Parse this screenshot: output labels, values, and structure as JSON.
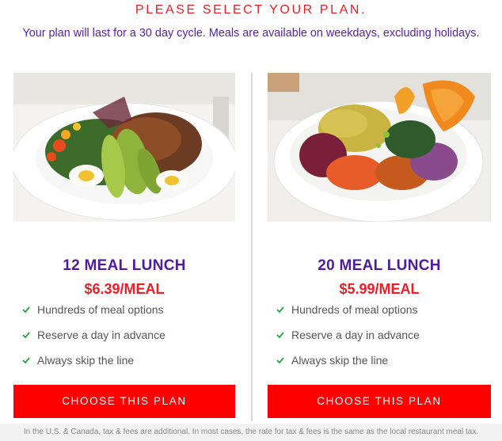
{
  "header": {
    "title": "PLEASE SELECT YOUR PLAN.",
    "subtitle": "Your plan will last for a 30 day cycle. Meals are available on weekdays, excluding holidays."
  },
  "plans": [
    {
      "image_alt": "Salad with egg, avocado, tomatoes and greens",
      "title": "12 MEAL LUNCH",
      "price": "$6.39/MEAL",
      "features": [
        "Hundreds of meal options",
        "Reserve a day in advance",
        "Always skip the line"
      ],
      "cta_label": "CHOOSE THIS PLAN"
    },
    {
      "image_alt": "Grain bowl with sweet potato, greens and slaw",
      "title": "20 MEAL LUNCH",
      "price": "$5.99/MEAL",
      "features": [
        "Hundreds of meal options",
        "Reserve a day in advance",
        "Always skip the line"
      ],
      "cta_label": "CHOOSE THIS PLAN"
    }
  ],
  "footer": {
    "disclaimer": "In the U.S. & Canada, tax & fees are additional. In most cases, the rate for tax & fees is the same as the local restaurant meal tax."
  },
  "colors": {
    "accent_red": "#ee1c24",
    "accent_purple": "#4f1c9e",
    "check_green": "#22a33a",
    "button_red": "#ff0000"
  },
  "icons": {
    "feature": "check-icon"
  }
}
